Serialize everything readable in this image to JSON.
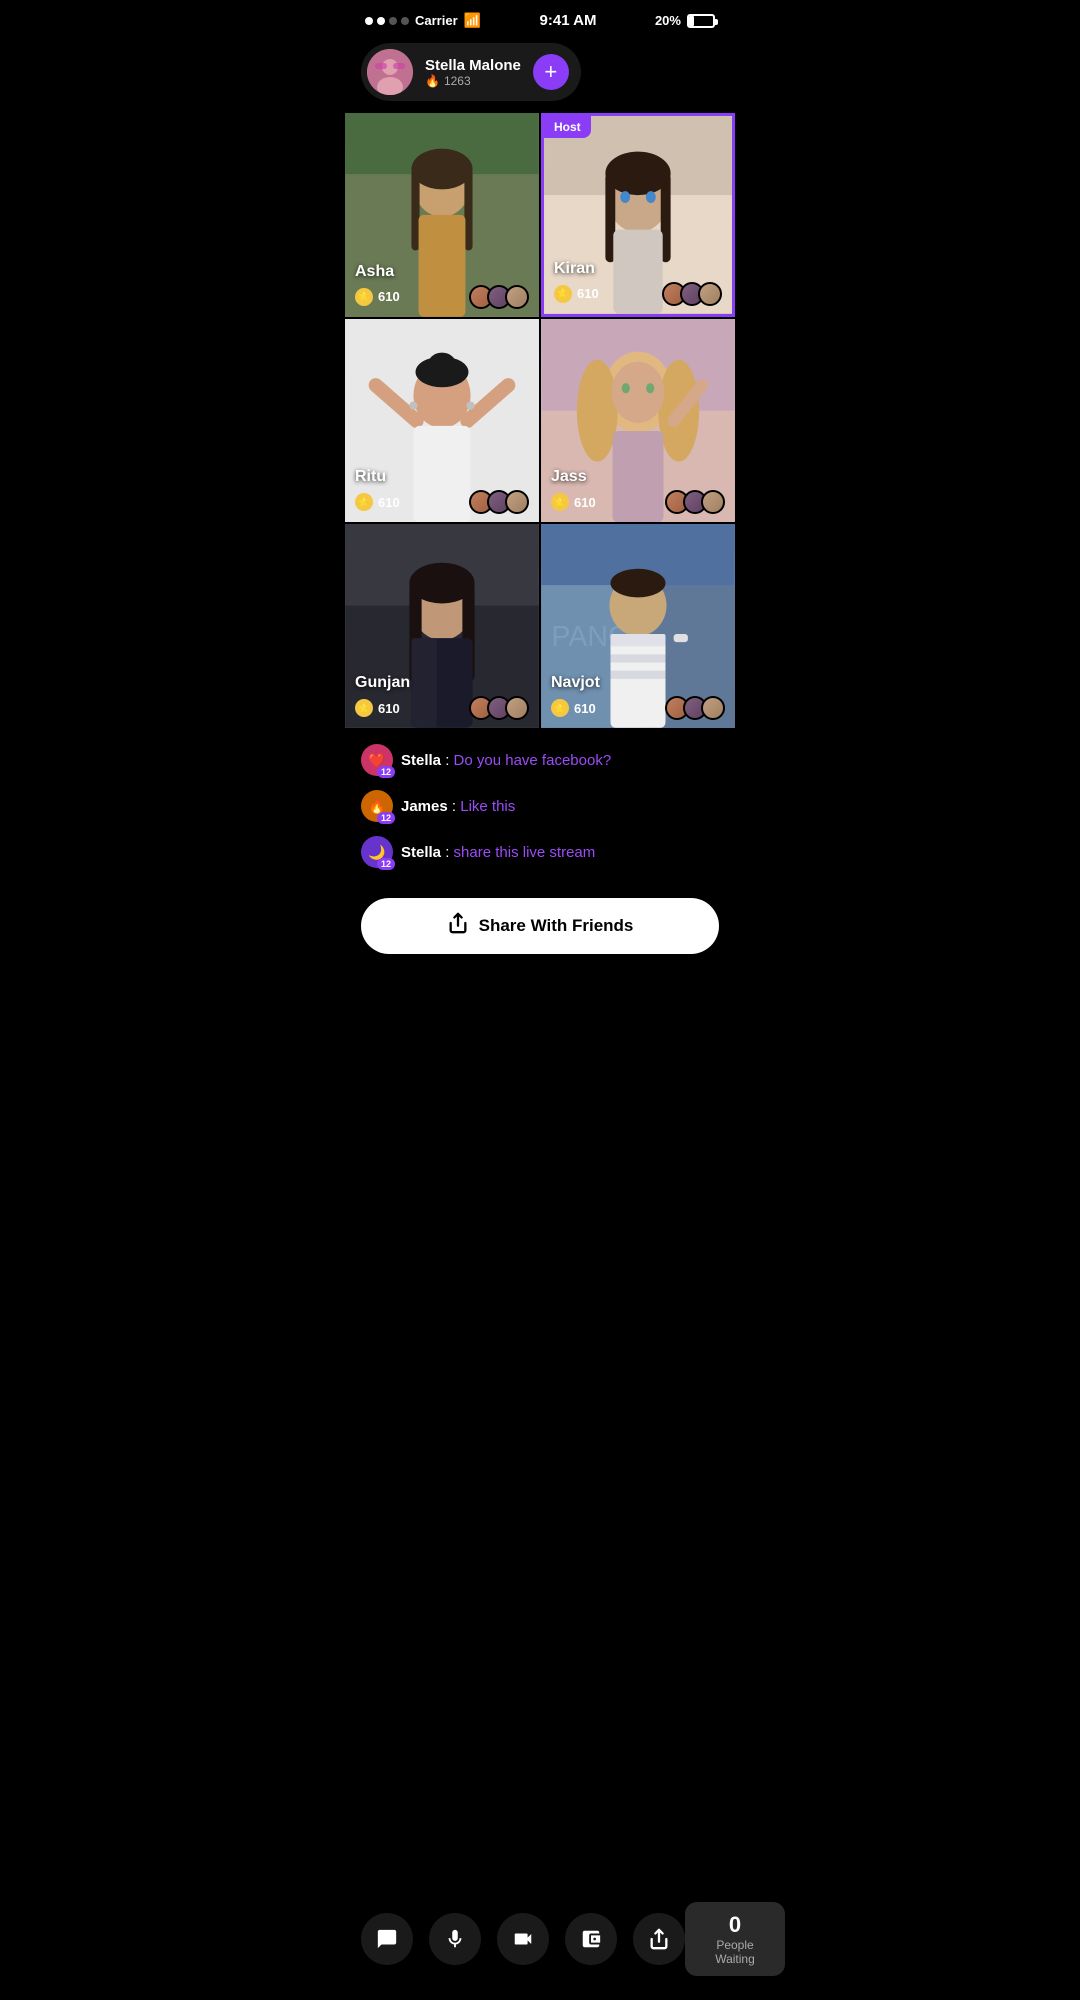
{
  "statusBar": {
    "carrier": "Carrier",
    "time": "9:41 AM",
    "battery": "20%"
  },
  "userCard": {
    "name": "Stella Malone",
    "score": "1263",
    "addLabel": "+"
  },
  "grid": {
    "cells": [
      {
        "id": "asha",
        "name": "Asha",
        "coins": "610",
        "isHost": false,
        "bg": "bg-asha"
      },
      {
        "id": "kiran",
        "name": "Kiran",
        "coins": "610",
        "isHost": true,
        "bg": "bg-kiran"
      },
      {
        "id": "ritu",
        "name": "Ritu",
        "coins": "610",
        "isHost": false,
        "bg": "bg-ritu"
      },
      {
        "id": "jass",
        "name": "Jass",
        "coins": "610",
        "isHost": false,
        "bg": "bg-jass"
      },
      {
        "id": "gunjan",
        "name": "Gunjan",
        "coins": "610",
        "isHost": false,
        "bg": "bg-gunjan"
      },
      {
        "id": "navjot",
        "name": "Navjot",
        "coins": "610",
        "isHost": false,
        "bg": "bg-navjot"
      }
    ],
    "hostLabel": "Host"
  },
  "chat": {
    "messages": [
      {
        "user": "Stella",
        "text": "Do you have facebook?",
        "badgeType": "heart",
        "level": "12"
      },
      {
        "user": "James",
        "text": "Like this",
        "badgeType": "fire",
        "level": "12"
      },
      {
        "user": "Stella",
        "text": "share this live stream",
        "badgeType": "purple",
        "level": "12"
      }
    ]
  },
  "shareBtn": {
    "label": "Share With Friends"
  },
  "bottomBar": {
    "actions": [
      {
        "id": "chat",
        "icon": "💬"
      },
      {
        "id": "mic",
        "icon": "🎤"
      },
      {
        "id": "video",
        "icon": "🎥"
      },
      {
        "id": "wallet",
        "icon": "👛"
      },
      {
        "id": "share",
        "icon": "↗"
      }
    ],
    "peopleWaiting": {
      "count": "0",
      "label": "People Waiting"
    }
  }
}
